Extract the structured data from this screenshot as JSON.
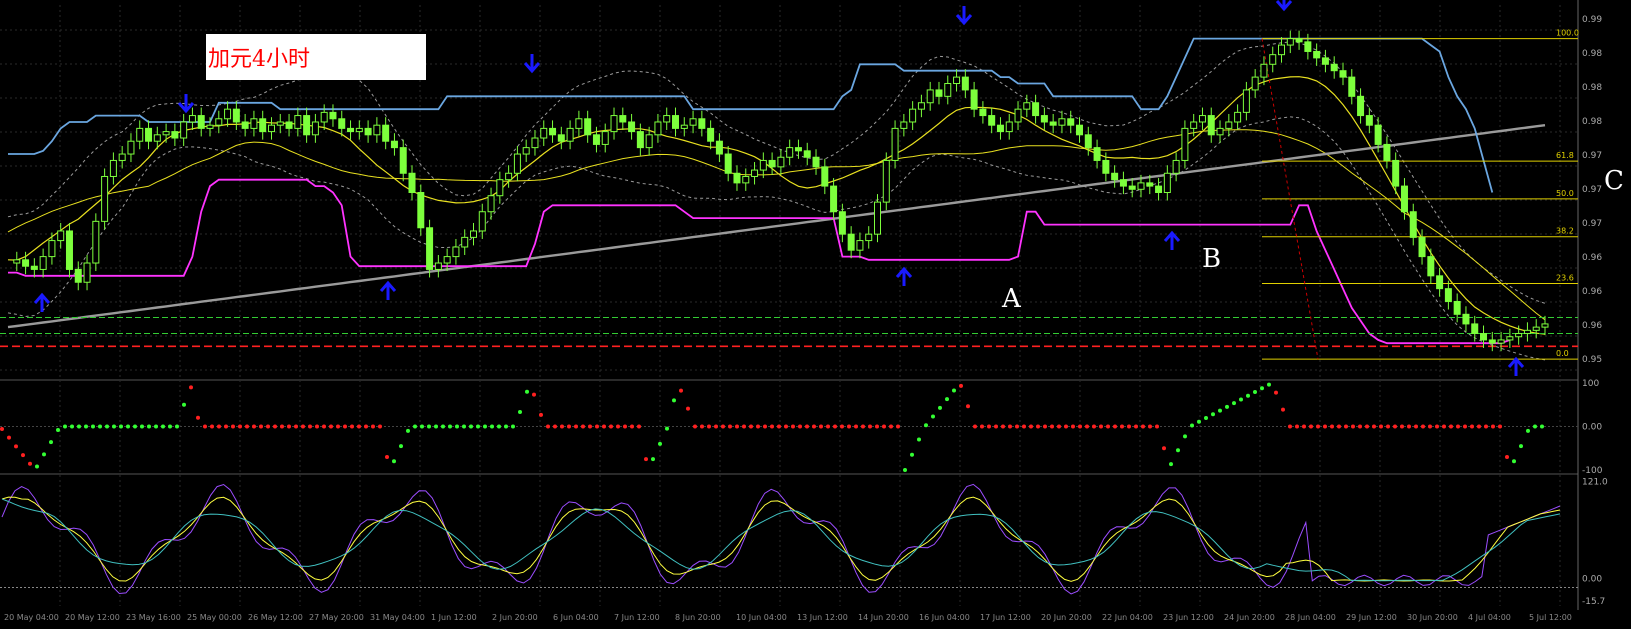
{
  "chart_title": "加元4小时",
  "annotations": [
    {
      "text": "A"
    },
    {
      "text": "B"
    },
    {
      "text": "C"
    }
  ],
  "colors": {
    "background": "#000000",
    "grid": "#2a2a2a",
    "candle": "#7dff3c",
    "upper_channel": "#6aa6e0",
    "lower_channel": "#ff33ff",
    "ma_yellow": "#e8e020",
    "ma_gray": "#9a9a9a",
    "bollinger": "#9a9a9a",
    "arrow": "#1a1aff",
    "fib": "#e0d000",
    "support_red": "#ff2020",
    "support_green": "#33cc33",
    "osc_red": "#ff2020",
    "osc_green": "#33ff33",
    "stoch_purple": "#9b4dff",
    "stoch_yellow": "#ffff40",
    "stoch_cyan": "#40c0c0"
  },
  "chart_data": {
    "type": "candlestick",
    "x_tick_labels": [
      "20 May 04:00",
      "20 May 12:00",
      "23 May 16:00",
      "25 May 00:00",
      "26 May 12:00",
      "27 May 20:00",
      "31 May 04:00",
      "1 Jun 12:00",
      "2 Jun 20:00",
      "6 Jun 04:00",
      "7 Jun 12:00",
      "8 Jun 20:00",
      "10 Jun 04:00",
      "13 Jun 12:00",
      "14 Jun 20:00",
      "16 Jun 04:00",
      "17 Jun 12:00",
      "20 Jun 20:00",
      "22 Jun 04:00",
      "23 Jun 12:00",
      "24 Jun 20:00",
      "28 Jun 04:00",
      "29 Jun 12:00",
      "30 Jun 20:00",
      "4 Jul 04:00",
      "5 Jul 12:00"
    ],
    "price_axis_labels": [
      "0.99",
      "0.98",
      "0.98",
      "0.98",
      "0.97",
      "0.97",
      "0.97",
      "0.96",
      "0.96",
      "0.96",
      "0.95"
    ],
    "fibonacci_levels": [
      {
        "label": "100.0",
        "value": 100.0
      },
      {
        "label": "61.8",
        "value": 61.8
      },
      {
        "label": "50.0",
        "value": 50.0
      },
      {
        "label": "38.2",
        "value": 38.2
      },
      {
        "label": "23.6",
        "value": 23.6
      },
      {
        "label": "0.0",
        "value": 0.0
      }
    ],
    "price_scale": {
      "min": 0,
      "max": 100
    },
    "close": [
      28,
      29,
      27,
      26,
      30,
      35,
      38,
      26,
      22,
      28,
      41,
      55,
      60,
      62,
      66,
      70,
      66,
      68,
      69,
      67,
      72,
      74,
      70,
      71,
      73,
      76,
      72,
      70,
      73,
      69,
      71,
      72,
      70,
      74,
      68,
      72,
      75,
      73,
      70,
      69,
      70,
      68,
      71,
      66,
      64,
      56,
      50,
      39,
      26,
      28,
      30,
      33,
      36,
      38,
      44,
      49,
      54,
      56,
      62,
      64,
      67,
      70,
      68,
      66,
      70,
      73,
      68,
      65,
      69,
      74,
      72,
      69,
      64,
      68,
      72,
      74,
      70,
      71,
      73,
      70,
      66,
      62,
      56,
      53,
      55,
      57,
      60,
      58,
      61,
      64,
      63,
      61,
      58,
      52,
      44,
      37,
      32,
      35,
      37,
      47,
      60,
      70,
      72,
      76,
      78,
      82,
      80,
      84,
      86,
      82,
      76,
      74,
      71,
      69,
      72,
      76,
      78,
      74,
      72,
      71,
      73,
      71,
      68,
      64,
      60,
      56,
      54,
      52,
      51,
      53,
      52,
      50,
      56,
      60,
      70,
      72,
      74,
      68,
      70,
      72,
      75,
      82,
      86,
      90,
      93,
      96,
      98,
      97,
      94,
      92,
      90,
      88,
      86,
      80,
      74,
      71,
      65,
      60,
      52,
      44,
      36,
      30,
      24,
      20,
      16,
      12,
      9,
      6,
      4,
      3,
      4,
      5,
      6,
      7,
      8,
      9
    ],
    "upper_channel": [
      62,
      62,
      62,
      62,
      63,
      66,
      70,
      72,
      72,
      72,
      74,
      74,
      74,
      74,
      74,
      74,
      72,
      72,
      72,
      72,
      72,
      72,
      72,
      72,
      78,
      78,
      78,
      78,
      78,
      78,
      78,
      76,
      76,
      76,
      76,
      76,
      76,
      76,
      76,
      76,
      76,
      76,
      76,
      76,
      76,
      76,
      76,
      76,
      76,
      76,
      80,
      80,
      80,
      80,
      80,
      80,
      80,
      80,
      80,
      80,
      80,
      80,
      80,
      80,
      80,
      80,
      80,
      80,
      80,
      80,
      80,
      80,
      80,
      80,
      80,
      80,
      80,
      80,
      76,
      76,
      76,
      76,
      76,
      76,
      76,
      76,
      76,
      76,
      76,
      76,
      76,
      76,
      76,
      76,
      76,
      80,
      82,
      90,
      90,
      90,
      90,
      90,
      88,
      88,
      88,
      88,
      88,
      88,
      88,
      88,
      88,
      88,
      88,
      86,
      86,
      84,
      84,
      84,
      84,
      80,
      80,
      80,
      80,
      80,
      80,
      80,
      80,
      80,
      80,
      76,
      76,
      76,
      80,
      86,
      92,
      98,
      98,
      98,
      98,
      98,
      98,
      98,
      98,
      98,
      98,
      98,
      98,
      98,
      98,
      98,
      98,
      98,
      98,
      98,
      98,
      98,
      98,
      98,
      98,
      98,
      98,
      98,
      96,
      94,
      86,
      80,
      76,
      70,
      60,
      50
    ],
    "lower_channel": [
      25,
      25,
      24,
      24,
      24,
      24,
      24,
      24,
      24,
      24,
      24,
      24,
      24,
      24,
      24,
      24,
      24,
      24,
      24,
      24,
      24,
      30,
      44,
      52,
      54,
      54,
      54,
      54,
      54,
      54,
      54,
      54,
      54,
      54,
      54,
      52,
      52,
      50,
      46,
      30,
      27,
      27,
      27,
      27,
      27,
      27,
      27,
      27,
      27,
      27,
      27,
      27,
      27,
      27,
      27,
      27,
      27,
      27,
      27,
      27,
      34,
      44,
      46,
      46,
      46,
      46,
      46,
      46,
      46,
      46,
      46,
      46,
      46,
      46,
      46,
      46,
      46,
      44,
      42,
      42,
      42,
      42,
      42,
      42,
      42,
      42,
      42,
      42,
      42,
      42,
      42,
      42,
      42,
      42,
      42,
      30,
      30,
      30,
      29,
      29,
      29,
      29,
      29,
      29,
      29,
      29,
      29,
      29,
      29,
      29,
      29,
      29,
      29,
      29,
      29,
      30,
      44,
      44,
      40,
      40,
      40,
      40,
      40,
      40,
      40,
      40,
      40,
      40,
      40,
      40,
      40,
      40,
      40,
      40,
      40,
      40,
      40,
      40,
      40,
      40,
      40,
      40,
      40,
      40,
      40,
      40,
      40,
      46,
      46,
      38,
      32,
      26,
      20,
      14,
      10,
      6,
      4,
      3,
      3,
      3,
      3,
      3,
      3,
      3,
      3,
      3,
      3,
      3,
      3,
      3,
      3,
      4
    ]
  },
  "oscillator": {
    "axis_labels": [
      "100",
      "0.00",
      "-100"
    ]
  },
  "stochastic": {
    "axis_labels": [
      "121.0",
      "-15.7",
      "0.00"
    ]
  }
}
